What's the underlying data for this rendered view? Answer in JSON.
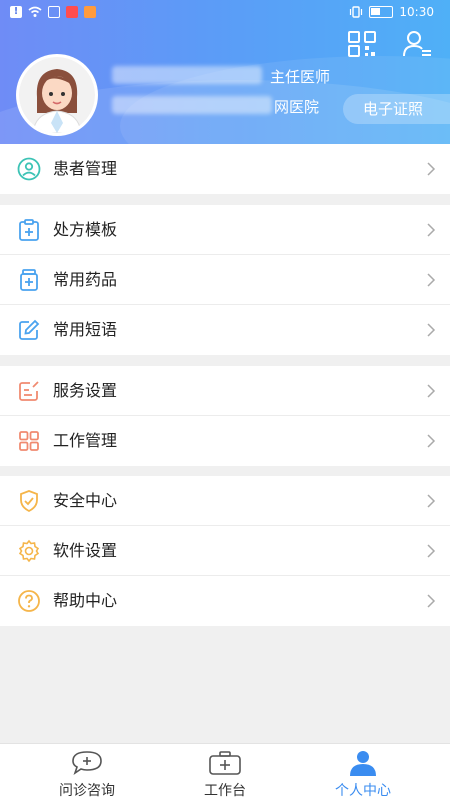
{
  "status_bar": {
    "time": "10:30"
  },
  "profile": {
    "title_suffix": "主任医师",
    "hospital_suffix": "网医院",
    "certificate_button": "电子证照"
  },
  "icons": {
    "qr": "qr-code-icon",
    "user_list": "user-list-icon"
  },
  "menu_groups": [
    {
      "items": [
        {
          "label": "患者管理",
          "icon": "patient-icon",
          "color": "#3cc3b5"
        }
      ]
    },
    {
      "items": [
        {
          "label": "处方模板",
          "icon": "prescription-icon",
          "color": "#4aa3ef"
        },
        {
          "label": "常用药品",
          "icon": "medicine-icon",
          "color": "#4aa3ef"
        },
        {
          "label": "常用短语",
          "icon": "edit-icon",
          "color": "#4aa3ef"
        }
      ]
    },
    {
      "items": [
        {
          "label": "服务设置",
          "icon": "service-icon",
          "color": "#f08a70"
        },
        {
          "label": "工作管理",
          "icon": "grid-icon",
          "color": "#f08a70"
        }
      ]
    },
    {
      "items": [
        {
          "label": "安全中心",
          "icon": "shield-icon",
          "color": "#f5b54a"
        },
        {
          "label": "软件设置",
          "icon": "gear-icon",
          "color": "#f5b54a"
        },
        {
          "label": "帮助中心",
          "icon": "help-icon",
          "color": "#f5b54a"
        }
      ]
    }
  ],
  "bottom_nav": [
    {
      "label": "问诊咨询",
      "icon": "chat-plus-icon",
      "active": false
    },
    {
      "label": "工作台",
      "icon": "medical-kit-icon",
      "active": false
    },
    {
      "label": "个人中心",
      "icon": "person-icon",
      "active": true
    }
  ],
  "colors": {
    "accent": "#3a8cf0",
    "header_start": "#6f8cf6",
    "header_end": "#4fb0f7"
  }
}
